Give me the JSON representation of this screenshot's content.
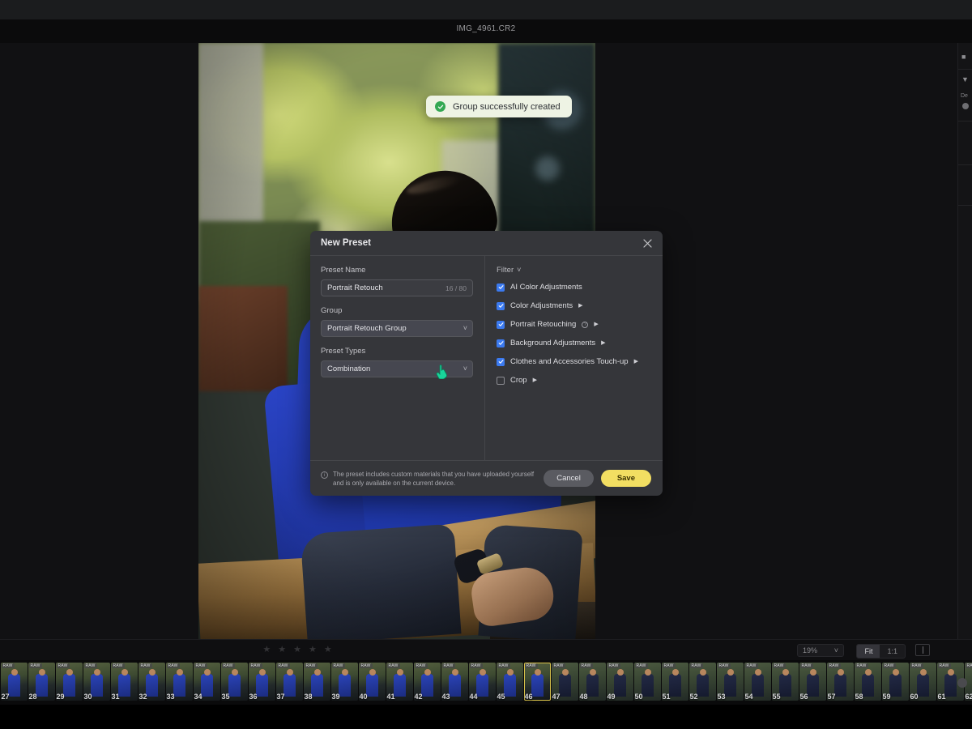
{
  "app": {
    "document_title": "IMG_4961.CR2"
  },
  "toast": {
    "icon": "check-circle-icon",
    "message": "Group successfully created"
  },
  "modal": {
    "title": "New Preset",
    "close_icon": "close-icon",
    "preset_name": {
      "label": "Preset Name",
      "value": "Portrait Retouch",
      "placeholder": "Preset Name",
      "counter": "16 / 80"
    },
    "group": {
      "label": "Group",
      "value": "Portrait Retouch Group",
      "chevron": "chevron-down-icon"
    },
    "preset_types": {
      "label": "Preset Types",
      "value": "Combination",
      "chevron": "chevron-down-icon"
    },
    "filter": {
      "label": "Filter",
      "chevron": "chevron-down-icon",
      "items": [
        {
          "label": "AI Color Adjustments",
          "checked": true,
          "has_arrow": false,
          "has_info": false
        },
        {
          "label": "Color Adjustments",
          "checked": true,
          "has_arrow": true,
          "has_info": false
        },
        {
          "label": "Portrait Retouching",
          "checked": true,
          "has_arrow": true,
          "has_info": true
        },
        {
          "label": "Background Adjustments",
          "checked": true,
          "has_arrow": true,
          "has_info": false
        },
        {
          "label": "Clothes and Accessories Touch-up",
          "checked": true,
          "has_arrow": true,
          "has_info": false
        },
        {
          "label": "Crop",
          "checked": false,
          "has_arrow": true,
          "has_info": false
        }
      ]
    },
    "footer": {
      "info_icon": "info-icon",
      "note": "The preset includes custom materials that you have uploaded yourself and is only available on the current device.",
      "cancel_label": "Cancel",
      "save_label": "Save"
    },
    "colors": {
      "checkbox_on": "#3b7af0",
      "save_button": "#f2de62",
      "cancel_button": "#5a5b61",
      "modal_bg": "#35363a"
    }
  },
  "bottom_bar": {
    "rating_stars": 5,
    "rating_value": 0,
    "zoom_level": "19%",
    "zoom_chevron": "chevron-down-icon",
    "fit_label": "Fit",
    "one_to_one_label": "1:1",
    "compare_icon": "compare-split-icon",
    "info_icon": "info-icon"
  },
  "filmstrip": {
    "selected_index": 46,
    "raw_badge": "RAW",
    "thumbnails": [
      {
        "num": "27"
      },
      {
        "num": "28"
      },
      {
        "num": "29"
      },
      {
        "num": "30"
      },
      {
        "num": "31"
      },
      {
        "num": "32"
      },
      {
        "num": "33"
      },
      {
        "num": "34"
      },
      {
        "num": "35"
      },
      {
        "num": "36"
      },
      {
        "num": "37"
      },
      {
        "num": "38"
      },
      {
        "num": "39"
      },
      {
        "num": "40"
      },
      {
        "num": "41"
      },
      {
        "num": "42"
      },
      {
        "num": "43"
      },
      {
        "num": "44"
      },
      {
        "num": "45"
      },
      {
        "num": "46"
      },
      {
        "num": "47"
      },
      {
        "num": "48"
      },
      {
        "num": "49"
      },
      {
        "num": "50"
      },
      {
        "num": "51"
      },
      {
        "num": "52"
      },
      {
        "num": "53"
      },
      {
        "num": "54"
      },
      {
        "num": "55"
      },
      {
        "num": "56"
      },
      {
        "num": "57"
      },
      {
        "num": "58"
      },
      {
        "num": "59"
      },
      {
        "num": "60"
      },
      {
        "num": "61"
      },
      {
        "num": "62"
      }
    ]
  },
  "right_rail": {
    "icons": [
      "crop-icon",
      "funnel-icon"
    ],
    "partial_label": "De"
  }
}
